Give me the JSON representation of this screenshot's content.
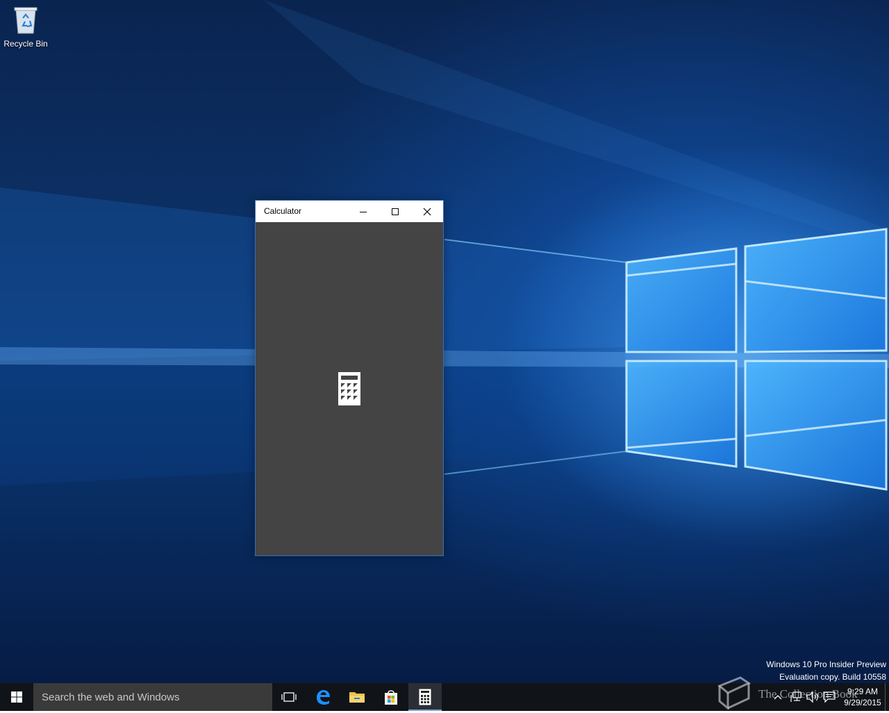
{
  "desktop": {
    "icons": [
      {
        "label": "Recycle Bin",
        "icon": "recycle-bin-icon"
      }
    ],
    "watermark": {
      "line1": "Windows 10 Pro Insider Preview",
      "line2": "Evaluation copy. Build 10558"
    }
  },
  "calculator_window": {
    "title": "Calculator",
    "controls": [
      "minimize-icon",
      "maximize-icon",
      "close-icon"
    ],
    "splash_icon": "calculator-icon",
    "colors": {
      "titlebar": "#ffffff",
      "body": "#444444",
      "border": "#3a6fb5"
    }
  },
  "taskbar": {
    "search_placeholder": "Search the web and Windows",
    "pinned": [
      {
        "name": "task-view",
        "icon": "task-view-icon"
      },
      {
        "name": "edge",
        "icon": "edge-icon"
      },
      {
        "name": "file-explorer",
        "icon": "folder-icon"
      },
      {
        "name": "store",
        "icon": "store-icon"
      },
      {
        "name": "calculator",
        "icon": "calculator-icon",
        "active": true
      }
    ],
    "overlay_text": "The Collection Book",
    "clock": {
      "time": "9:29 AM",
      "date": "9/29/2015"
    },
    "colors": {
      "background": "#101418",
      "search": "#3a3a3a",
      "active_indicator": "#7aa7e0"
    }
  }
}
